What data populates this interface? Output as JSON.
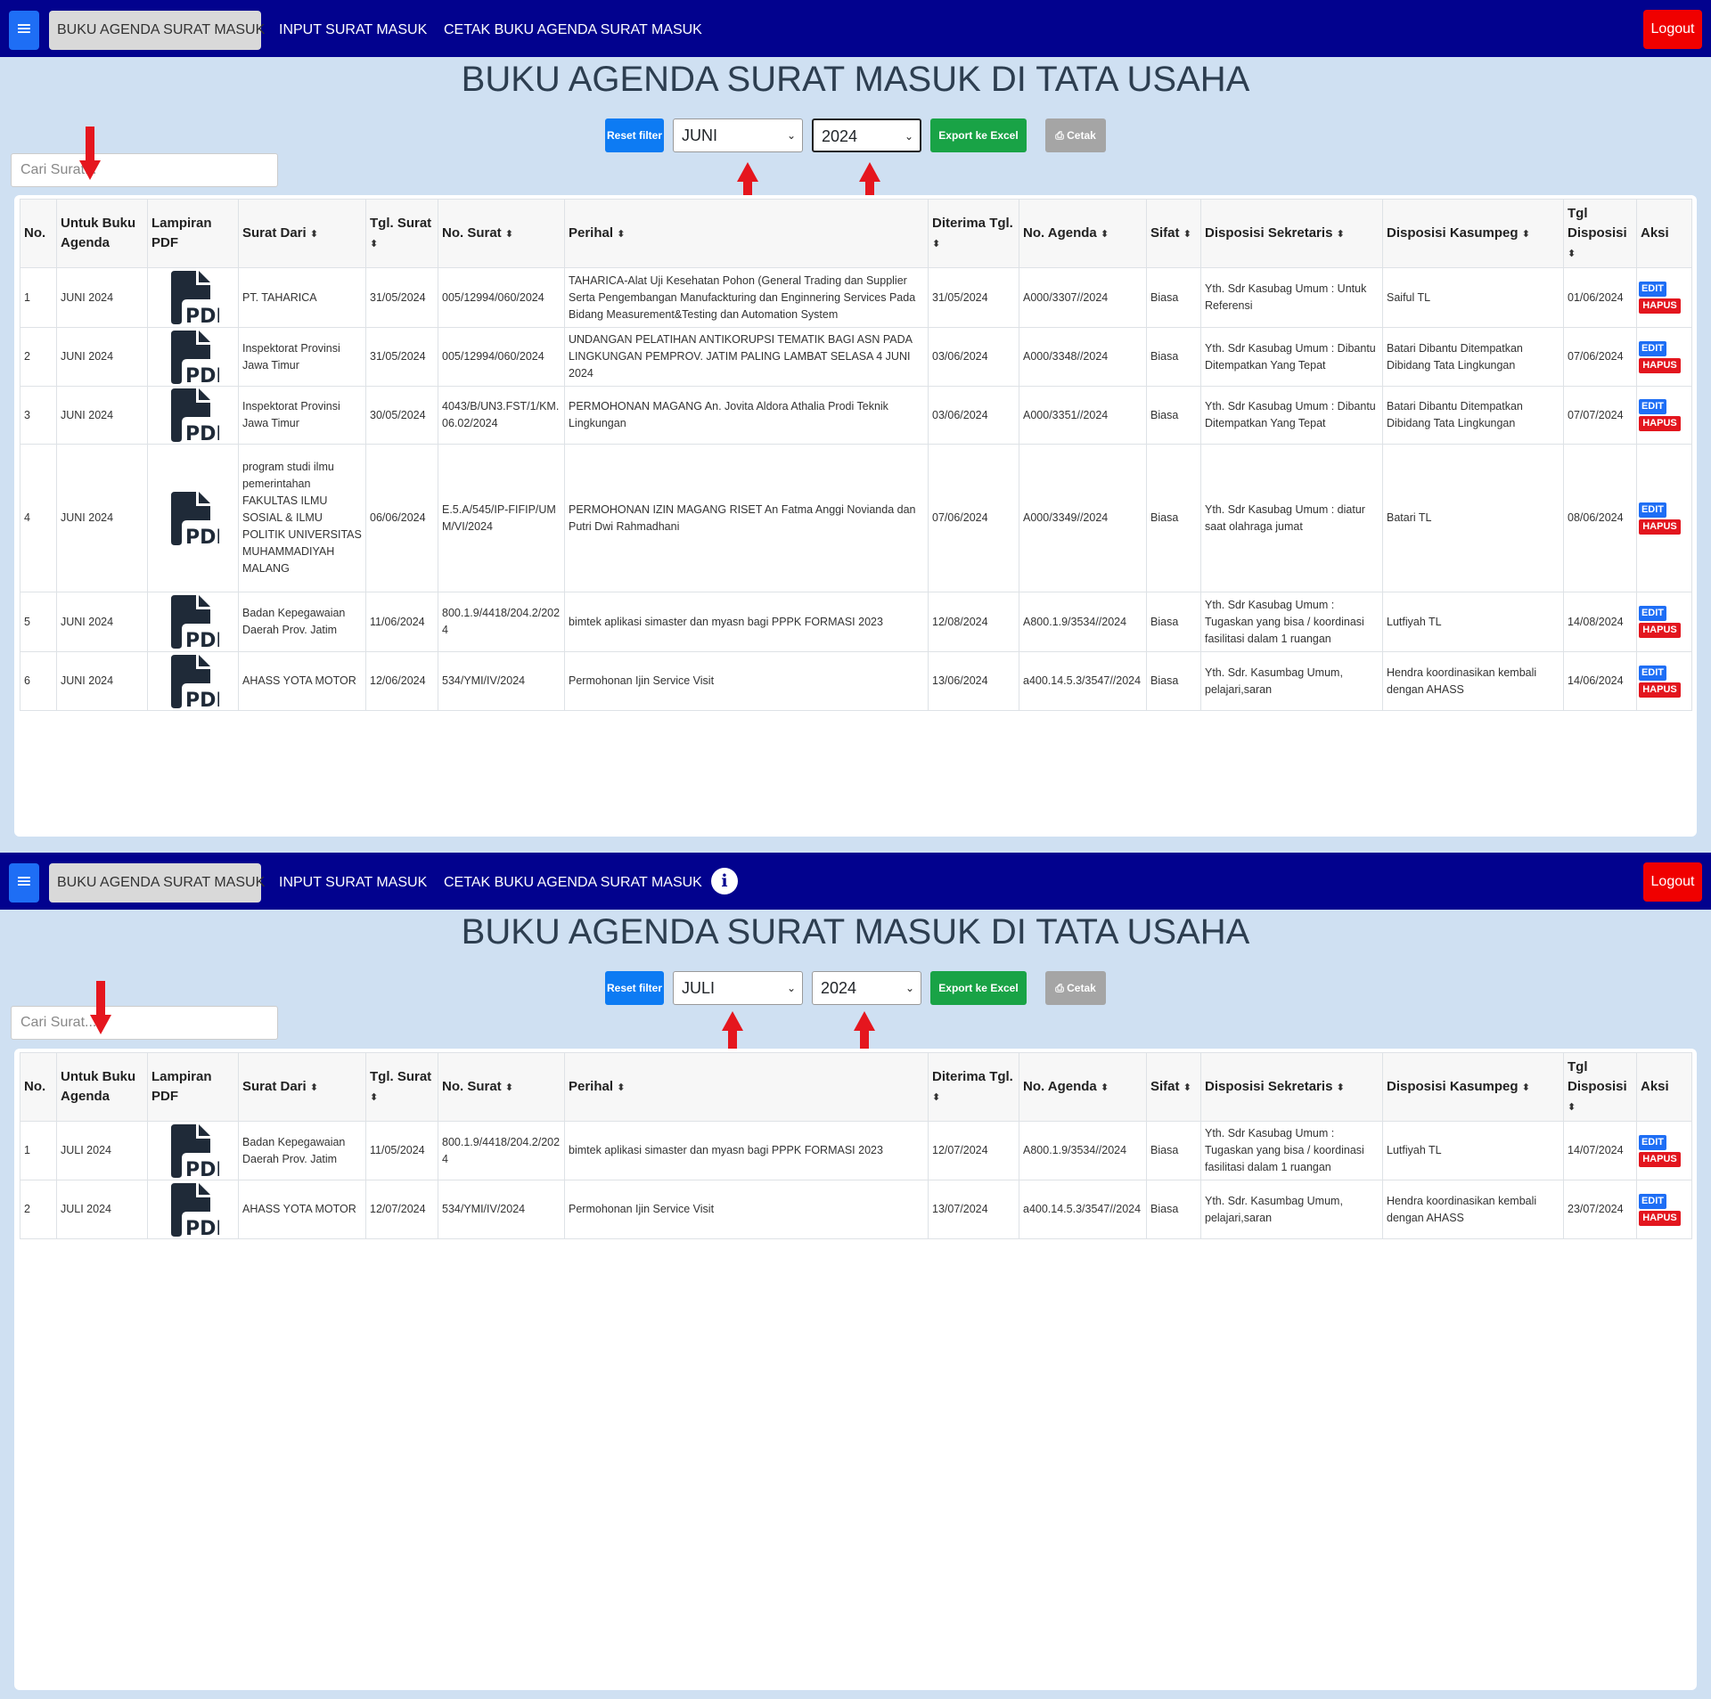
{
  "panels": [
    {
      "nav": {
        "menu_icon": "≡",
        "items": [
          "BUKU AGENDA SURAT MASUK",
          "INPUT SURAT MASUK",
          "CETAK BUKU AGENDA SURAT MASUK"
        ],
        "logout": "Logout"
      },
      "title": "BUKU AGENDA SURAT MASUK DI TATA USAHA",
      "filters": {
        "reset": "Reset filter",
        "month": "JUNI",
        "year": "2024",
        "export": "Export ke Excel",
        "print": "Cetak"
      },
      "search_placeholder": "Cari Surat...",
      "table": {
        "headers": [
          "No.",
          "Untuk Buku Agenda",
          "Lampiran PDF",
          "Surat Dari",
          "Tgl. Surat",
          "No. Surat",
          "Perihal",
          "Diterima Tgl.",
          "No. Agenda",
          "Sifat",
          "Disposisi Sekretaris",
          "Disposisi Kasumpeg",
          "Tgl Disposisi",
          "Aksi"
        ],
        "rows": [
          [
            "1",
            "JUNI 2024",
            "PT. TAHARICA",
            "31/05/2024",
            "005/12994/060/2024",
            "TAHARICA-Alat Uji Kesehatan Pohon (General Trading dan Supplier Serta Pengembangan Manufackturing dan Enginnering Services Pada Bidang Measurement&Testing dan Automation System",
            "31/05/2024",
            "A000/3307//2024",
            "Biasa",
            "Yth. Sdr Kasubag Umum : Untuk Referensi",
            "Saiful TL",
            "01/06/2024"
          ],
          [
            "2",
            "JUNI 2024",
            "Inspektorat Provinsi Jawa Timur",
            "31/05/2024",
            "005/12994/060/2024",
            "UNDANGAN PELATIHAN ANTIKORUPSI TEMATIK BAGI ASN PADA LINGKUNGAN PEMPROV. JATIM PALING LAMBAT SELASA 4 JUNI 2024",
            "03/06/2024",
            "A000/3348//2024",
            "Biasa",
            "Yth. Sdr Kasubag Umum : Dibantu Ditempatkan Yang Tepat",
            "Batari Dibantu Ditempatkan Dibidang Tata Lingkungan",
            "07/06/2024"
          ],
          [
            "3",
            "JUNI 2024",
            "Inspektorat Provinsi Jawa Timur",
            "30/05/2024",
            "4043/B/UN3.FST/1/KM.06.02/2024",
            "PERMOHONAN MAGANG An. Jovita Aldora Athalia Prodi Teknik Lingkungan",
            "03/06/2024",
            "A000/3351//2024",
            "Biasa",
            "Yth. Sdr Kasubag Umum : Dibantu Ditempatkan Yang Tepat",
            "Batari Dibantu Ditempatkan Dibidang Tata Lingkungan",
            "07/07/2024"
          ],
          [
            "4",
            "JUNI 2024",
            "program studi ilmu pemerintahan FAKULTAS ILMU SOSIAL & ILMU POLITIK UNIVERSITAS MUHAMMADIYAH MALANG",
            "06/06/2024",
            "E.5.A/545/IP-FIFIP/UMM/VI/2024",
            "PERMOHONAN IZIN MAGANG RISET An Fatma Anggi Novianda dan Putri Dwi Rahmadhani",
            "07/06/2024",
            "A000/3349//2024",
            "Biasa",
            "Yth. Sdr Kasubag Umum : diatur saat olahraga jumat",
            "Batari TL",
            "08/06/2024"
          ],
          [
            "5",
            "JUNI 2024",
            "Badan Kepegawaian Daerah Prov. Jatim",
            "11/06/2024",
            "800.1.9/4418/204.2/2024",
            "bimtek aplikasi simaster dan myasn bagi PPPK FORMASI 2023",
            "12/08/2024",
            "A800.1.9/3534//2024",
            "Biasa",
            "Yth. Sdr Kasubag Umum : Tugaskan yang bisa / koordinasi fasilitasi dalam 1 ruangan",
            "Lutfiyah TL",
            "14/08/2024"
          ],
          [
            "6",
            "JUNI 2024",
            "AHASS YOTA MOTOR",
            "12/06/2024",
            "534/YMI/IV/2024",
            "Permohonan Ijin Service Visit",
            "13/06/2024",
            "a400.14.5.3/3547//2024",
            "Biasa",
            "Yth. Sdr. Kasumbag Umum, pelajari,saran",
            "Hendra koordinasikan kembali dengan AHASS",
            "14/06/2024"
          ]
        ]
      }
    },
    {
      "nav": {
        "menu_icon": "≡",
        "items": [
          "BUKU AGENDA SURAT MASUK",
          "INPUT SURAT MASUK",
          "CETAK BUKU AGENDA SURAT MASUK"
        ],
        "info_icon": "i",
        "logout": "Logout"
      },
      "title": "BUKU AGENDA SURAT MASUK DI TATA USAHA",
      "filters": {
        "reset": "Reset filter",
        "month": "JULI",
        "year": "2024",
        "export": "Export ke Excel",
        "print": "Cetak"
      },
      "search_placeholder": "Cari Surat...",
      "table": {
        "headers": [
          "No.",
          "Untuk Buku Agenda",
          "Lampiran PDF",
          "Surat Dari",
          "Tgl. Surat",
          "No. Surat",
          "Perihal",
          "Diterima Tgl.",
          "No. Agenda",
          "Sifat",
          "Disposisi Sekretaris",
          "Disposisi Kasumpeg",
          "Tgl Disposisi",
          "Aksi"
        ],
        "rows": [
          [
            "1",
            "JULI 2024",
            "Badan Kepegawaian Daerah Prov. Jatim",
            "11/05/2024",
            "800.1.9/4418/204.2/2024",
            "bimtek aplikasi simaster dan myasn bagi PPPK FORMASI 2023",
            "12/07/2024",
            "A800.1.9/3534//2024",
            "Biasa",
            "Yth. Sdr Kasubag Umum : Tugaskan yang bisa / koordinasi fasilitasi dalam 1 ruangan",
            "Lutfiyah TL",
            "14/07/2024"
          ],
          [
            "2",
            "JULI 2024",
            "AHASS YOTA MOTOR",
            "12/07/2024",
            "534/YMI/IV/2024",
            "Permohonan Ijin Service Visit",
            "13/07/2024",
            "a400.14.5.3/3547//2024",
            "Biasa",
            "Yth. Sdr. Kasumbag Umum, pelajari,saran",
            "Hendra koordinasikan kembali dengan AHASS",
            "23/07/2024"
          ]
        ]
      }
    }
  ],
  "labels": {
    "pdf": "PDF",
    "edit": "EDIT",
    "hapus": "HAPUS",
    "sort_icon": "⬍"
  },
  "icons": {
    "menu": "hamburger-icon",
    "pdf": "pdf-file-icon",
    "print": "printer-icon",
    "info": "info-icon",
    "arrow": "red-arrow-annotation"
  },
  "colors": {
    "navbar": "#02028e",
    "background": "#cfe0f2",
    "logout": "#f00000",
    "excel": "#19a346",
    "reset": "#0d7bf3",
    "edit": "#1e6ef5",
    "hapus": "#e3161e",
    "arrow": "#e5161e"
  }
}
